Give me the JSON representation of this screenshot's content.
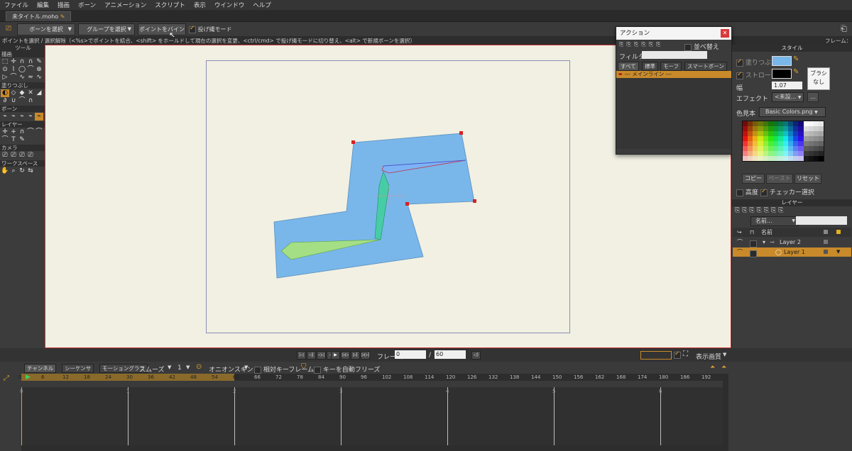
{
  "menu": [
    "ファイル",
    "編集",
    "描画",
    "ボーン",
    "アニメーション",
    "スクリプト",
    "表示",
    "ウインドウ",
    "ヘルプ"
  ],
  "doc_tab": "未タイトル.moho",
  "toolbar": {
    "select_bone": "ボーンを選択",
    "select_group": "グループを選択",
    "bind_points": "ポイントをバインド",
    "cast_mode": "投げ縄モード"
  },
  "status": {
    "text": "ポイントを選択 / 選択解除（<%s>でポイントを結合、<shift> をホールドして現在の選択を変更、<ctrl/cmd> で投げ縄モードに切り替え、<alt> で新規ボーンを選択）",
    "frame": "フレーム：0"
  },
  "tools": {
    "header": "ツール",
    "sections": [
      {
        "label": "描画",
        "icons": [
          "⬚",
          "✛",
          "∩",
          "∩",
          "✎",
          "⊙",
          "⌇",
          "◯",
          "⌒",
          "⊕",
          "▷",
          "⌒",
          "∿",
          "≈",
          "∿"
        ]
      },
      {
        "label": "塗りつぶし",
        "icons": [
          "◐",
          "◇",
          "◆",
          "✕",
          "◢",
          "∂",
          "∪",
          "⌒",
          "∩"
        ]
      },
      {
        "label": "ボーン",
        "icons": [
          "⌁",
          "⌁",
          "⌁",
          "⌁",
          "⌁"
        ]
      },
      {
        "label": "レイヤー",
        "icons": [
          "✛",
          "+",
          "∩",
          "⌒",
          "⌒",
          "⌒",
          "T",
          "✎"
        ]
      },
      {
        "label": "カメラ",
        "icons": [
          "⎚",
          "⎚",
          "⎚",
          "⎚"
        ]
      },
      {
        "label": "ワークスペース",
        "icons": [
          "✋",
          "⌕",
          "↻",
          "⇆"
        ]
      }
    ]
  },
  "actions_panel": {
    "title": "アクション",
    "sort": "並べ替え",
    "filter_label": "フィルター:",
    "tabs": [
      "すべて",
      "標準",
      "モーフ",
      "スマートボーン"
    ],
    "mainline": "--- メインライン ---"
  },
  "style_panel": {
    "title": "スタイル",
    "fill": "塗りつぶし",
    "stroke": "ストローク",
    "width_label": "幅",
    "width_value": "1.07",
    "no_brush": "ブラシなし",
    "effect_label": "エフェクト",
    "effect_value": "<未設...",
    "ellipsis": "...",
    "palette_label": "色見本",
    "palette_value": "Basic Colors.png",
    "copy": "コピー",
    "paste": "ペースト",
    "reset": "リセット",
    "advanced": "高度",
    "checker": "チェッカー選択",
    "fill_color": "#79b7ea",
    "stroke_color": "#000000"
  },
  "layers_panel": {
    "title": "レイヤー",
    "name_dropdown": "名前...",
    "col_name": "名前",
    "layers": [
      {
        "name": "Layer 2",
        "kind": "bone"
      },
      {
        "name": "Layer 1",
        "kind": "vector"
      }
    ]
  },
  "playback": {
    "frame_label": "フレーム",
    "frame_value": "0",
    "separator": "/",
    "end_value": "60",
    "quality": "表示画質"
  },
  "timeline": {
    "tabs": [
      "チャンネル",
      "シーケンサ",
      "モーショングラフ"
    ],
    "interp": "スムーズ",
    "interp_num": "1",
    "onion": "オニオンスキン",
    "relative_keys": "相対キーフレーム",
    "freeze_keys": "キーを自動フリーズ",
    "ruler": [
      "0",
      "6",
      "12",
      "18",
      "24",
      "30",
      "36",
      "42",
      "48",
      "54",
      "60",
      "66",
      "72",
      "78",
      "84",
      "90",
      "96",
      "102",
      "108",
      "114",
      "120",
      "126",
      "132",
      "138",
      "144",
      "150",
      "156",
      "162",
      "168",
      "174",
      "180",
      "186",
      "192"
    ],
    "seconds": [
      "0",
      "1",
      "2",
      "3",
      "4",
      "5",
      "6"
    ]
  },
  "colors": {
    "accent": "#c88a2a",
    "canvas_bg": "#f1f0e2",
    "shape_fill": "#79b7ea",
    "canvas_border": "#c8383c"
  }
}
